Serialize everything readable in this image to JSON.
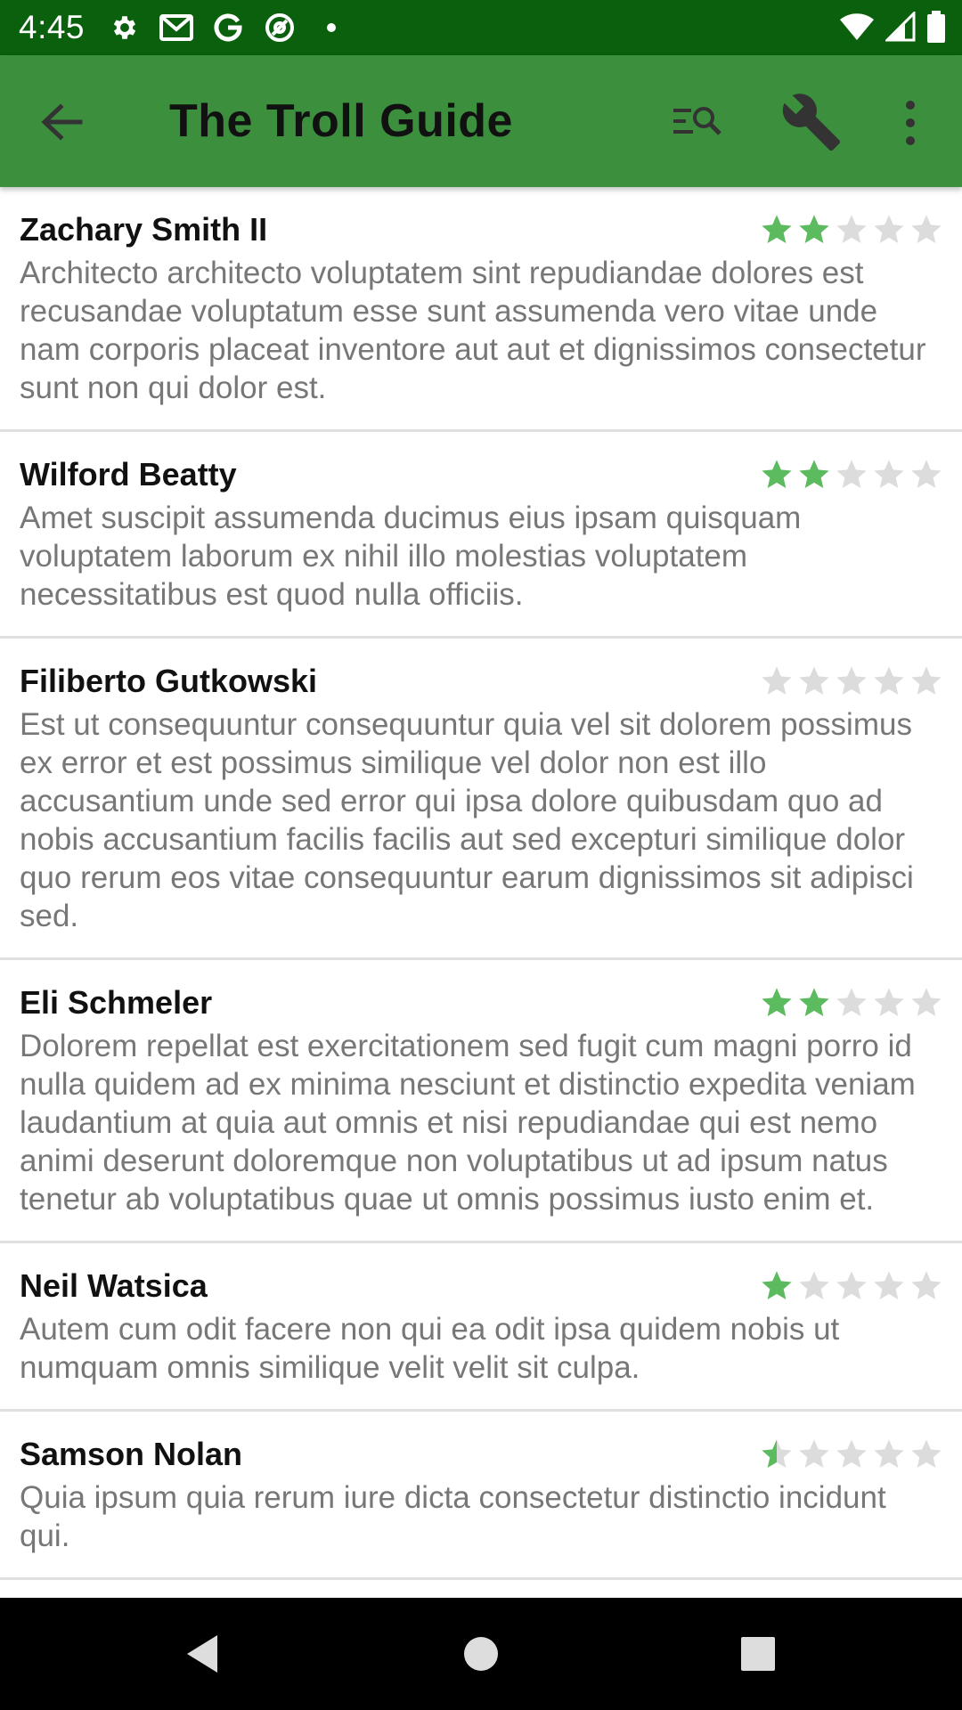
{
  "status_bar": {
    "time": "4:45",
    "background": "#0a600c"
  },
  "app_bar": {
    "title": "The Troll Guide",
    "background": "#3b8f3d",
    "icons": [
      "back-arrow-icon",
      "filter-search-icon",
      "wrench-icon",
      "more-vert-icon"
    ]
  },
  "colors": {
    "star_filled": "#5cba5f",
    "star_empty": "#dcdcdc"
  },
  "reviews": [
    {
      "name": "Zachary Smith II",
      "rating": 2,
      "text": "Architecto architecto voluptatem sint repudiandae dolores est recusandae voluptatum esse sunt assumenda vero vitae unde nam corporis placeat inventore aut aut et dignissimos consectetur sunt non qui dolor est."
    },
    {
      "name": "Wilford Beatty",
      "rating": 2,
      "text": "Amet suscipit assumenda ducimus eius ipsam quisquam voluptatem laborum ex nihil illo molestias voluptatem necessitatibus est quod nulla officiis."
    },
    {
      "name": "Filiberto Gutkowski",
      "rating": 0,
      "text": "Est ut consequuntur consequuntur quia vel sit dolorem possimus ex error et est possimus similique vel dolor non est illo accusantium unde sed error qui ipsa dolore quibusdam quo ad nobis accusantium facilis facilis aut sed excepturi similique dolor quo rerum eos vitae consequuntur earum dignissimos sit adipisci sed."
    },
    {
      "name": "Eli Schmeler",
      "rating": 2,
      "text": "Dolorem repellat est exercitationem sed fugit cum magni porro id nulla quidem ad ex minima nesciunt et distinctio expedita veniam laudantium at quia aut omnis et nisi repudiandae qui est nemo animi deserunt doloremque non voluptatibus ut ad ipsum natus tenetur ab voluptatibus quae ut omnis possimus iusto enim et."
    },
    {
      "name": "Neil Watsica",
      "rating": 1,
      "text": "Autem cum odit facere non qui ea odit ipsa quidem nobis ut numquam omnis similique velit velit sit culpa."
    },
    {
      "name": "Samson Nolan",
      "rating": 0.5,
      "text": "Quia ipsum quia rerum iure dicta consectetur distinctio incidunt qui."
    }
  ]
}
